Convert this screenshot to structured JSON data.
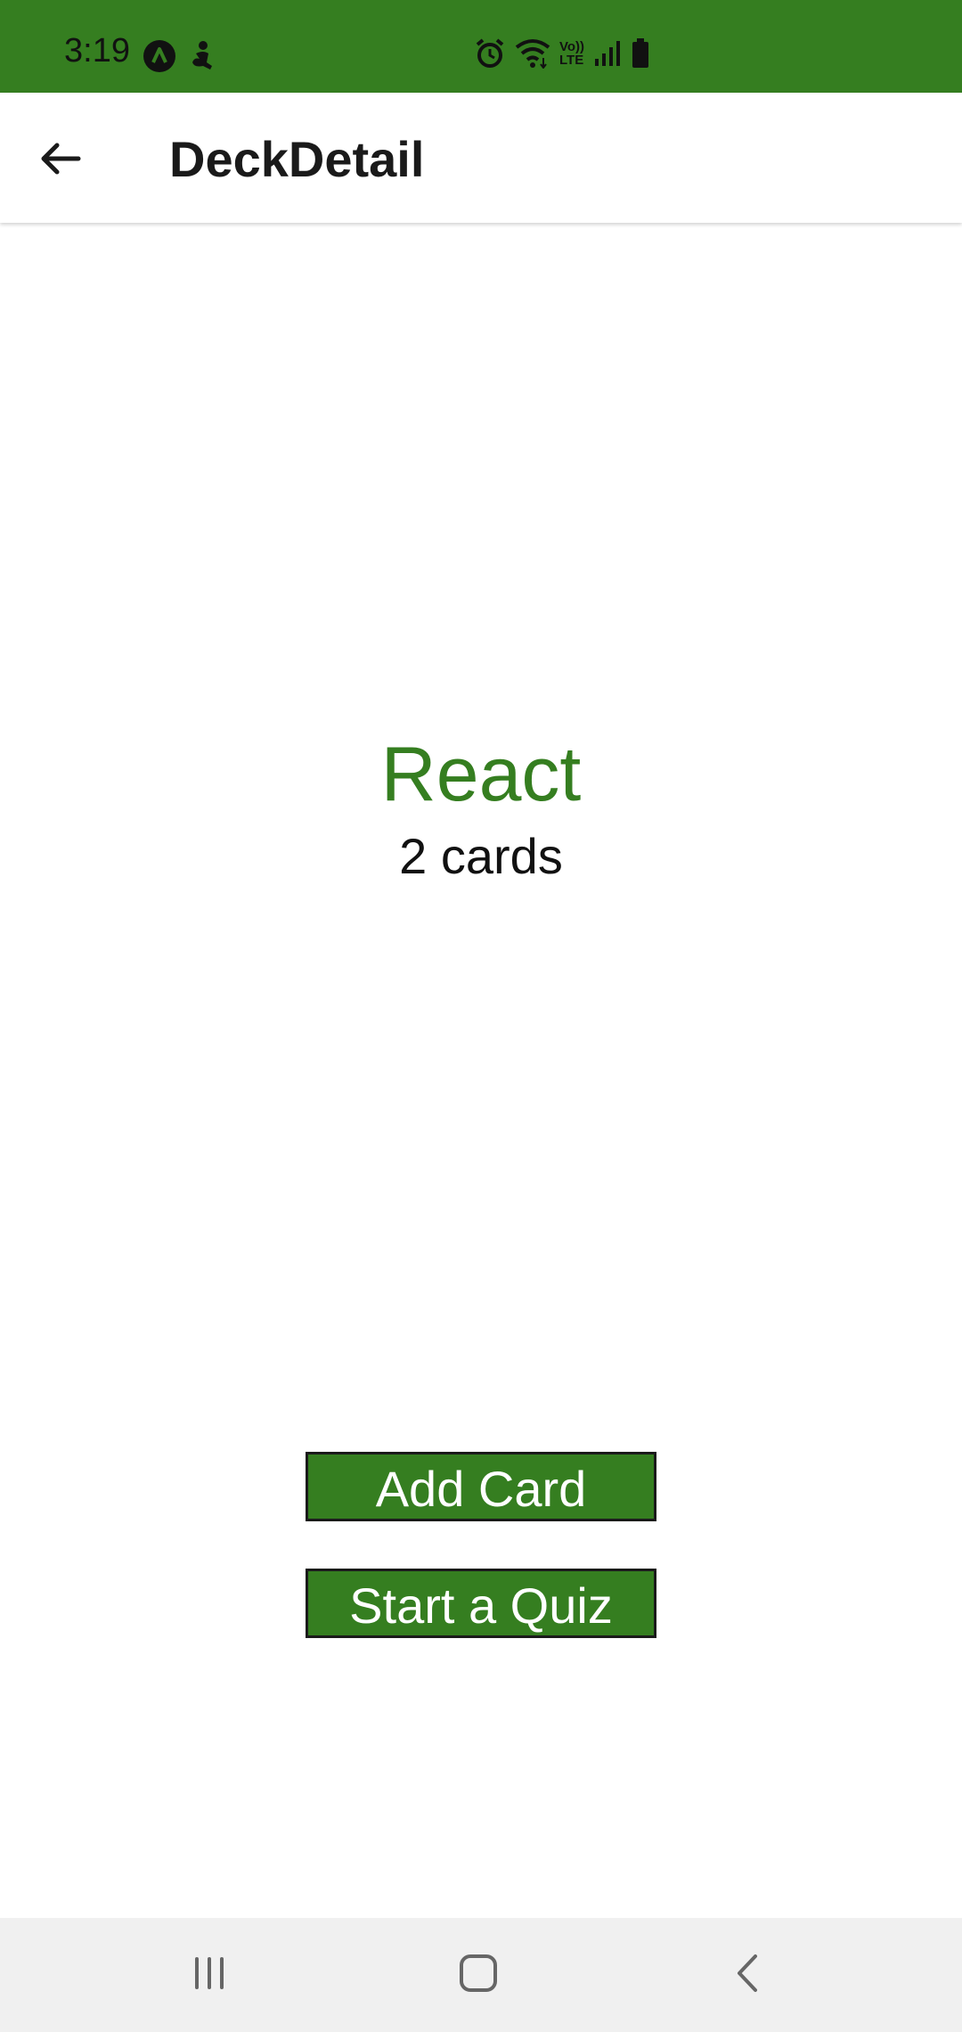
{
  "status_bar": {
    "time": "3:19",
    "background_color": "#357e20",
    "left_icons": [
      "navigation-app-icon",
      "accessibility-icon"
    ],
    "right_icons": [
      "alarm-icon",
      "wifi-icon",
      "volte-icon",
      "signal-icon",
      "battery-icon"
    ],
    "volte_label_top": "Vo))",
    "volte_label_bottom": "LTE"
  },
  "app_bar": {
    "title": "DeckDetail",
    "back_icon": "arrow-left-icon"
  },
  "deck": {
    "title": "React",
    "card_count": "2 cards",
    "title_color": "#357e20"
  },
  "actions": {
    "add_card_label": "Add Card",
    "start_quiz_label": "Start a Quiz",
    "button_color": "#357e20"
  },
  "nav_bar": {
    "icons": [
      "recents-icon",
      "home-icon",
      "back-icon"
    ]
  }
}
